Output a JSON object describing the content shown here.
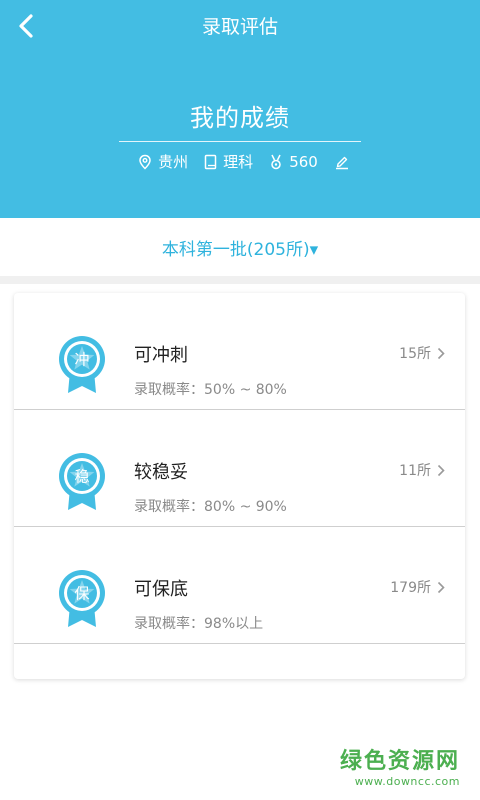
{
  "header": {
    "title": "录取评估",
    "score_title": "我的成绩",
    "province": "贵州",
    "subject": "理科",
    "score": "560"
  },
  "batch": {
    "label": "本科第一批(205所)▾"
  },
  "items": [
    {
      "badge": "冲",
      "title": "可冲刺",
      "rate": "录取概率：50% ~ 80%",
      "count": "15所"
    },
    {
      "badge": "稳",
      "title": "较稳妥",
      "rate": "录取概率：80% ~ 90%",
      "count": "11所"
    },
    {
      "badge": "保",
      "title": "可保底",
      "rate": "录取概率：98%以上",
      "count": "179所"
    }
  ],
  "watermark": {
    "main": "绿色资源网",
    "sub": "www.downcc.com"
  },
  "colors": {
    "header_bg": "#43bde3",
    "accent": "#2fb3dd"
  }
}
